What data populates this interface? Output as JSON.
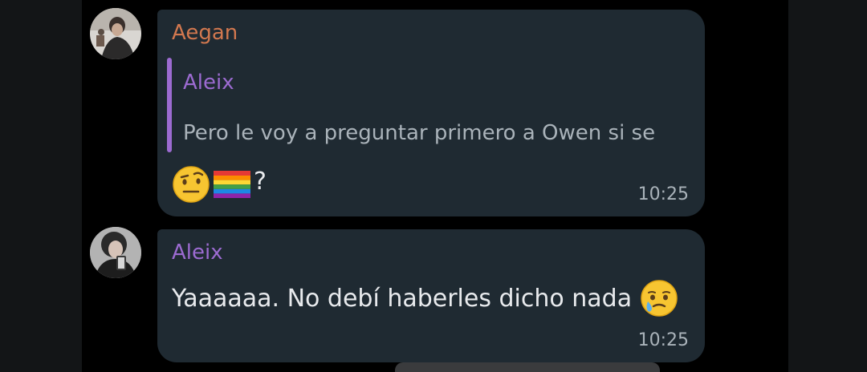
{
  "colors": {
    "chat_background": "#000000",
    "side_background": "#131517",
    "bubble_background": "#1f2a32",
    "sender_aegan": "#d2784f",
    "sender_aleix": "#9c6bd1",
    "reply_bar": "#9c6bd1",
    "message_text": "#e8eaed",
    "secondary_text": "#aab3ba"
  },
  "messages": [
    {
      "sender": "Aegan",
      "avatar": "avatar-aegan",
      "reply": {
        "author": "Aleix",
        "text": "Pero le voy a preguntar primero a Owen si se ven bien"
      },
      "emojis": [
        "face-with-raised-eyebrow-emoji",
        "rainbow-flag-emoji"
      ],
      "text": "?",
      "time": "10:25"
    },
    {
      "sender": "Aleix",
      "avatar": "avatar-aleix",
      "text": "Yaaaaaa. No debí haberles dicho nada",
      "emojis": [
        "face-holding-back-tears-emoji"
      ],
      "time": "10:25"
    }
  ]
}
